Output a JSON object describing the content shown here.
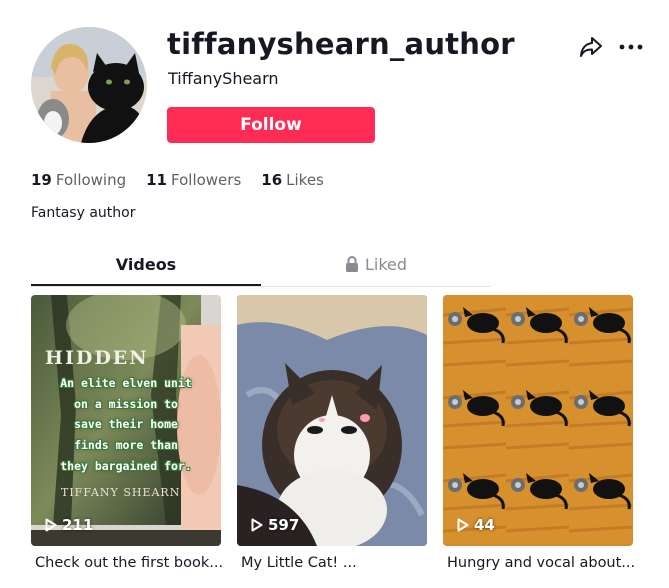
{
  "profile": {
    "username": "tiffanyshearn_author",
    "nickname": "TiffanyShearn",
    "follow_label": "Follow",
    "bio": "Fantasy author"
  },
  "stats": [
    {
      "count": "19",
      "label": "Following"
    },
    {
      "count": "11",
      "label": "Followers"
    },
    {
      "count": "16",
      "label": "Likes"
    }
  ],
  "tabs": {
    "videos": "Videos",
    "liked": "Liked",
    "liked_icon": "lock-icon"
  },
  "videos": [
    {
      "views": "211",
      "caption": "Check out the first book...",
      "book_title": "HIDDEN",
      "book_author": "TIFFANY SHEARN",
      "overlay_lines": [
        "An elite elven unit",
        "on a mission to",
        "save their home",
        "finds more than",
        "they bargained for."
      ]
    },
    {
      "views": "597",
      "caption": "My Little Cat! ..."
    },
    {
      "views": "44",
      "caption": "Hungry and vocal about..."
    }
  ],
  "icons": {
    "share": "share-icon",
    "more": "more-icon",
    "play": "play-icon"
  },
  "colors": {
    "accent": "#fe2c55",
    "text": "#161823",
    "muted": "#8a8b91"
  }
}
